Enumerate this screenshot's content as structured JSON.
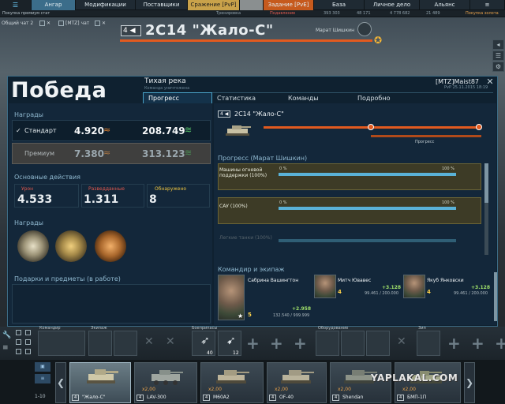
{
  "topnav": {
    "tabs": [
      {
        "label": "Ангар"
      },
      {
        "label": "Модификации"
      },
      {
        "label": "Поставщики"
      },
      {
        "label": "Сражение [PvP]"
      },
      {
        "label": "Задание [PvE]"
      },
      {
        "label": "База"
      },
      {
        "label": "Личное дело"
      },
      {
        "label": "Альянс"
      }
    ],
    "sub": {
      "left_notice": "Покупка премиум статуса",
      "training": "Тренировка",
      "platoon": "Подавление",
      "credits": "393 303",
      "gold": "48 171",
      "xp": "4 778 682",
      "free_xp": "21 489",
      "premium": "Покупка золота"
    }
  },
  "chat": {
    "tab1": "Общий чат 2",
    "tab2": "[MTZ] чат"
  },
  "banner": {
    "tier": "4",
    "tank_title": "2С14 \"Жало-С\"",
    "player_name": "Марат Шишкин"
  },
  "dialog": {
    "result": "Победа",
    "map": "Тихая река",
    "map_sub": "Команда уничтожена",
    "clan_player": "[MTZ]Maist87",
    "date": "PvP 25.11.2015 18:19",
    "tabs": [
      "Прогресс",
      "Статистика",
      "Команды",
      "Подробно"
    ],
    "rewards": {
      "title": "Награды",
      "standard_label": "Стандарт",
      "standard_xp": "4.920",
      "standard_credits": "208.749",
      "premium_label": "Премиум",
      "premium_xp": "7.380",
      "premium_credits": "313.123"
    },
    "actions": {
      "title": "Основные действия",
      "damage_label": "Урон",
      "damage": "4.533",
      "scout_label": "Разведданные",
      "scout": "1.311",
      "spotted_label": "Обнаружено",
      "spotted": "8"
    },
    "awards_title": "Награды",
    "gifts_title": "Подарки и предметы (в работе)",
    "tank": {
      "tier": "4",
      "name": "2С14 \"Жало-С\"",
      "progress_label": "Прогресс"
    },
    "progress": {
      "title": "Прогресс (Марат Шишкин)",
      "items": [
        {
          "label": "Машины огневой поддержки (100%)",
          "start": "0 %",
          "end": "100 %"
        },
        {
          "label": "САУ (100%)",
          "start": "0 %",
          "end": "100 %"
        },
        {
          "label": "Легкие танки (100%)"
        }
      ]
    },
    "crew": {
      "title": "Командир и экипаж",
      "commander": {
        "name": "Сабрина Вашингтон",
        "xp": "+2.958",
        "total": "132.540 / 999.999",
        "rank": "5"
      },
      "members": [
        {
          "name": "Митч Ювавес",
          "xp": "+3.128",
          "total": "99.461 / 200.000",
          "rank": "4"
        },
        {
          "name": "Якуб Янковски",
          "xp": "+3.128",
          "total": "99.461 / 200.000",
          "rank": "4"
        }
      ]
    }
  },
  "bottom": {
    "commander_lbl": "Командир",
    "crew_lbl": "Экипаж",
    "ammo_lbl": "Боеприпасы",
    "equip_lbl": "Оборудование",
    "consum_lbl": "Зип",
    "ammo1": "40",
    "ammo2": "12",
    "level_range": "1-10"
  },
  "carousel": [
    {
      "tier": "4",
      "name": "\"Жало-С\"",
      "x2": ""
    },
    {
      "tier": "4",
      "name": "LAV-300",
      "x2": "x2,00"
    },
    {
      "tier": "4",
      "name": "M60A2",
      "x2": "x2,00"
    },
    {
      "tier": "4",
      "name": "OF-40",
      "x2": "x2,00"
    },
    {
      "tier": "4",
      "name": "Shendan",
      "x2": "x2,00"
    },
    {
      "tier": "4",
      "name": "БМП-1П",
      "x2": "x2,00"
    }
  ],
  "watermark": "YAPLAKAL.COM",
  "colors": {
    "accent": "#4aa3c9",
    "orange": "#e25a1f",
    "xp_green": "#9fe06a",
    "progress": "#5ab2d8"
  }
}
